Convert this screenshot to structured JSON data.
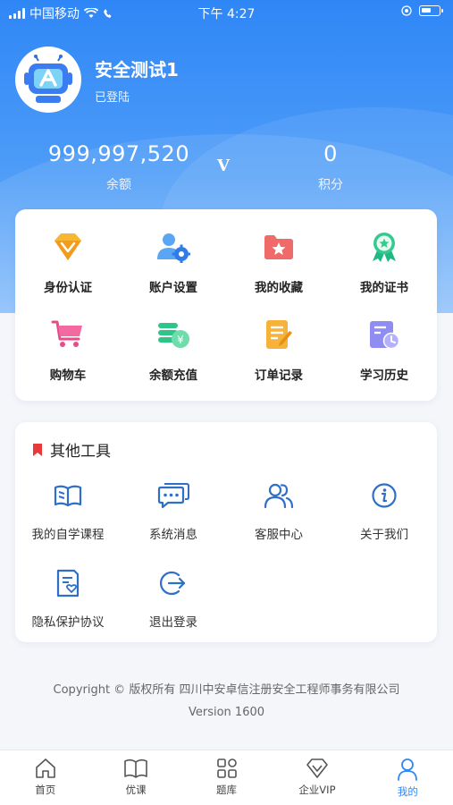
{
  "status_bar": {
    "carrier": "中国移动",
    "time": "下午 4:27"
  },
  "profile": {
    "username": "安全测试1",
    "login_status": "已登陆"
  },
  "stats": {
    "balance": {
      "value": "999,997,520",
      "label": "余额"
    },
    "vip_mark": "V",
    "points": {
      "value": "0",
      "label": "积分"
    }
  },
  "main_menu": [
    {
      "label": "身份认证",
      "icon": "diamond-icon"
    },
    {
      "label": "账户设置",
      "icon": "user-gear-icon"
    },
    {
      "label": "我的收藏",
      "icon": "folder-star-icon"
    },
    {
      "label": "我的证书",
      "icon": "medal-icon"
    },
    {
      "label": "购物车",
      "icon": "cart-icon"
    },
    {
      "label": "余额充值",
      "icon": "coins-icon"
    },
    {
      "label": "订单记录",
      "icon": "order-edit-icon"
    },
    {
      "label": "学习历史",
      "icon": "history-icon"
    }
  ],
  "tools": {
    "title": "其他工具",
    "items": [
      {
        "label": "我的自学课程",
        "icon": "book-icon"
      },
      {
        "label": "系统消息",
        "icon": "chat-icon"
      },
      {
        "label": "客服中心",
        "icon": "users-icon"
      },
      {
        "label": "关于我们",
        "icon": "info-icon"
      },
      {
        "label": "隐私保护协议",
        "icon": "doc-heart-icon"
      },
      {
        "label": "退出登录",
        "icon": "logout-icon"
      }
    ]
  },
  "footer": {
    "copyright": "Copyright © 版权所有 四川中安卓信注册安全工程师事务有限公司",
    "version": "Version 1600"
  },
  "tabbar": [
    {
      "label": "首页",
      "icon": "home-icon",
      "active": false
    },
    {
      "label": "优课",
      "icon": "open-book-icon",
      "active": false
    },
    {
      "label": "题库",
      "icon": "grid-icon",
      "active": false
    },
    {
      "label": "企业VIP",
      "icon": "diamond-outline-icon",
      "active": false
    },
    {
      "label": "我的",
      "icon": "person-icon",
      "active": true
    }
  ],
  "colors": {
    "primary": "#2f86f6",
    "background": "#f4f6fa"
  }
}
